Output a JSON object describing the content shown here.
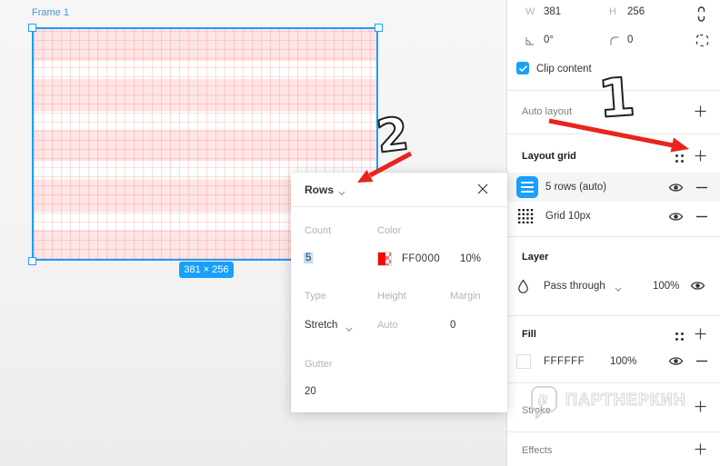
{
  "canvas": {
    "frame_label": "Frame 1",
    "size_badge": "381 × 256"
  },
  "popup": {
    "title": "Rows",
    "count_label": "Count",
    "count_value": "5",
    "color_label": "Color",
    "color_hex": "FF0000",
    "color_opacity": "10%",
    "type_label": "Type",
    "type_value": "Stretch",
    "height_label": "Height",
    "height_value": "Auto",
    "margin_label": "Margin",
    "margin_value": "0",
    "gutter_label": "Gutter",
    "gutter_value": "20"
  },
  "inspector": {
    "w_label": "W",
    "w_value": "381",
    "h_label": "H",
    "h_value": "256",
    "rotation_value": "0°",
    "radius_value": "0",
    "clip_label": "Clip content",
    "auto_layout_title": "Auto layout",
    "layout_grid_title": "Layout grid",
    "grid_items": [
      {
        "name": "5 rows (auto)"
      },
      {
        "name": "Grid 10px"
      }
    ],
    "layer_title": "Layer",
    "blend_mode": "Pass through",
    "layer_opacity": "100%",
    "fill_title": "Fill",
    "fill_hex": "FFFFFF",
    "fill_opacity": "100%",
    "stroke_title": "Stroke",
    "effects_title": "Effects"
  },
  "annotations": {
    "step1": "1",
    "step2": "2"
  },
  "watermark": {
    "text": "ПАРТНЕРКИН",
    "logo_glyph": "₽"
  },
  "colors": {
    "accent": "#18a0fb",
    "grid_red": "#FF0000",
    "arrow_red": "#e8241d",
    "selection_highlight": "#bcdcf7"
  }
}
